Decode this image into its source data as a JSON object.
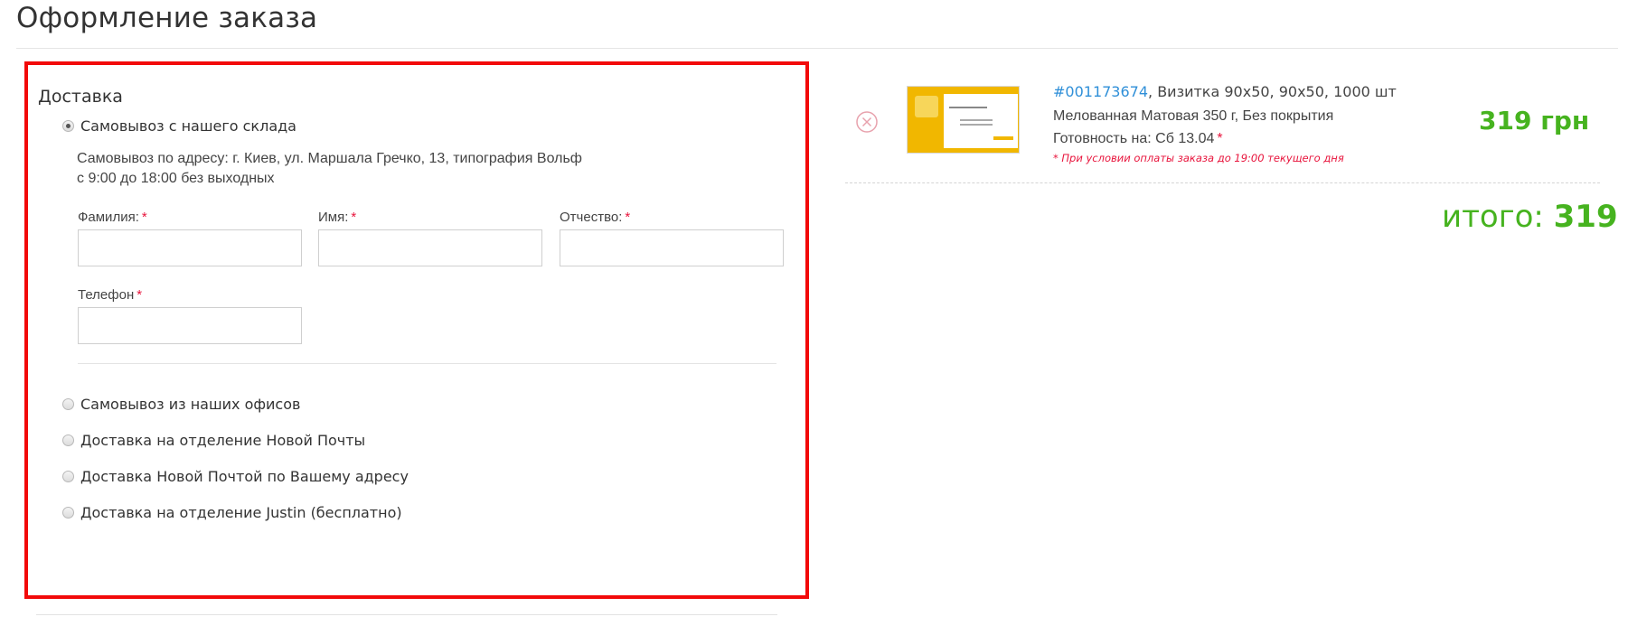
{
  "page_title": "Оформление заказа",
  "delivery": {
    "title": "Доставка",
    "options": [
      {
        "label": "Самовывоз с нашего склада",
        "checked": true
      },
      {
        "label": "Самовывоз из наших офисов",
        "checked": false
      },
      {
        "label": "Доставка на отделение Новой Почты",
        "checked": false
      },
      {
        "label": "Доставка Новой Почтой по Вашему адресу",
        "checked": false
      },
      {
        "label": "Доставка на отделение Justin (бесплатно)",
        "checked": false
      }
    ],
    "pickup_address": "Самовывоз по адресу: г. Киев, ул. Маршала Гречко, 13, типография Вольф",
    "pickup_hours": "с 9:00 до 18:00 без выходных",
    "fields": {
      "last_name": {
        "label": "Фамилия:",
        "value": ""
      },
      "first_name": {
        "label": "Имя:",
        "value": ""
      },
      "patronymic": {
        "label": "Отчество:",
        "value": ""
      },
      "phone": {
        "label": "Телефон",
        "value": ""
      }
    },
    "required_mark": "*"
  },
  "cart": {
    "item": {
      "order_id": "#001173674",
      "description": ", Визитка 90x50, 90x50, 1000 шт",
      "paper": "Мелованная Матовая 350 г, Без покрытия",
      "ready_label": "Готовность на: Сб 13.04",
      "note": "* При условии оплаты заказа до 19:00 текущего дня",
      "price": "319 грн",
      "remove_icon": "circle-x-icon"
    },
    "total_label": "итого:",
    "total_amount": "319 грн"
  },
  "colors": {
    "highlight_border": "#f20a0a",
    "price_green": "#46b31f",
    "link_blue": "#2f8fd8",
    "required_red": "#e8143c"
  }
}
